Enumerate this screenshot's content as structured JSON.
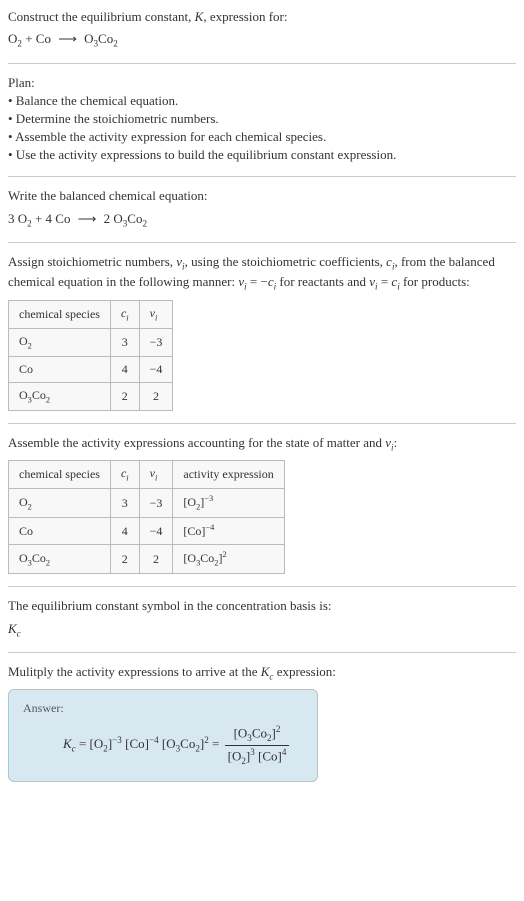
{
  "header": {
    "title": "Construct the equilibrium constant, K, expression for:",
    "equation_lhs": "O₂ + Co",
    "equation_arrow": "⟶",
    "equation_rhs": "O₃Co₂"
  },
  "plan": {
    "title": "Plan:",
    "bullets": [
      "• Balance the chemical equation.",
      "• Determine the stoichiometric numbers.",
      "• Assemble the activity expression for each chemical species.",
      "• Use the activity expressions to build the equilibrium constant expression."
    ]
  },
  "balanced": {
    "title": "Write the balanced chemical equation:",
    "equation": "3 O₂ + 4 Co  ⟶  2 O₃Co₂"
  },
  "stoich": {
    "intro_a": "Assign stoichiometric numbers, νᵢ, using the stoichiometric coefficients, cᵢ, from the balanced chemical equation in the following manner: νᵢ = −cᵢ for reactants and νᵢ = cᵢ for products:",
    "headers": [
      "chemical species",
      "cᵢ",
      "νᵢ"
    ],
    "rows": [
      [
        "O₂",
        "3",
        "−3"
      ],
      [
        "Co",
        "4",
        "−4"
      ],
      [
        "O₃Co₂",
        "2",
        "2"
      ]
    ]
  },
  "activity": {
    "intro": "Assemble the activity expressions accounting for the state of matter and νᵢ:",
    "headers": [
      "chemical species",
      "cᵢ",
      "νᵢ",
      "activity expression"
    ],
    "rows": [
      [
        "O₂",
        "3",
        "−3",
        "[O₂]⁻³"
      ],
      [
        "Co",
        "4",
        "−4",
        "[Co]⁻⁴"
      ],
      [
        "O₃Co₂",
        "2",
        "2",
        "[O₃Co₂]²"
      ]
    ]
  },
  "kc_symbol": {
    "line1": "The equilibrium constant symbol in the concentration basis is:",
    "line2": "K_c"
  },
  "multiply": {
    "text": "Mulitply the activity expressions to arrive at the K_c expression:"
  },
  "answer": {
    "label": "Answer:",
    "lhs": "K_c = [O₂]⁻³ [Co]⁻⁴ [O₃Co₂]² = ",
    "frac_num": "[O₃Co₂]²",
    "frac_den": "[O₂]³ [Co]⁴"
  }
}
